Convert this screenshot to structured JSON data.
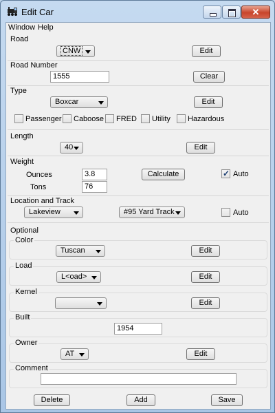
{
  "window": {
    "title": "Edit Car"
  },
  "menu": [
    "Window",
    "Help"
  ],
  "road": {
    "label": "Road",
    "value": "CNW",
    "edit": "Edit"
  },
  "road_number": {
    "label": "Road Number",
    "value": "1555",
    "clear": "Clear"
  },
  "type": {
    "label": "Type",
    "value": "Boxcar",
    "edit": "Edit",
    "options": [
      {
        "label": "Passenger",
        "checked": false
      },
      {
        "label": "Caboose",
        "checked": false
      },
      {
        "label": "FRED",
        "checked": false
      },
      {
        "label": "Utility",
        "checked": false
      },
      {
        "label": "Hazardous",
        "checked": false
      }
    ]
  },
  "length": {
    "label": "Length",
    "value": "40",
    "edit": "Edit"
  },
  "weight": {
    "label": "Weight",
    "ounces_label": "Ounces",
    "ounces": "3.8",
    "tons_label": "Tons",
    "tons": "76",
    "calculate": "Calculate",
    "auto": "Auto",
    "auto_checked": true
  },
  "location": {
    "label": "Location and Track",
    "location": "Lakeview",
    "track": "#95 Yard Track",
    "auto": "Auto",
    "auto_checked": false
  },
  "optional": {
    "label": "Optional"
  },
  "color": {
    "label": "Color",
    "value": "Tuscan",
    "edit": "Edit"
  },
  "load": {
    "label": "Load",
    "value": "L<oad>",
    "edit": "Edit"
  },
  "kernel": {
    "label": "Kernel",
    "value": "",
    "edit": "Edit"
  },
  "built": {
    "label": "Built",
    "value": "1954"
  },
  "owner": {
    "label": "Owner",
    "value": "AT",
    "edit": "Edit"
  },
  "comment": {
    "label": "Comment",
    "value": ""
  },
  "actions": {
    "delete": "Delete",
    "add": "Add",
    "save": "Save"
  }
}
